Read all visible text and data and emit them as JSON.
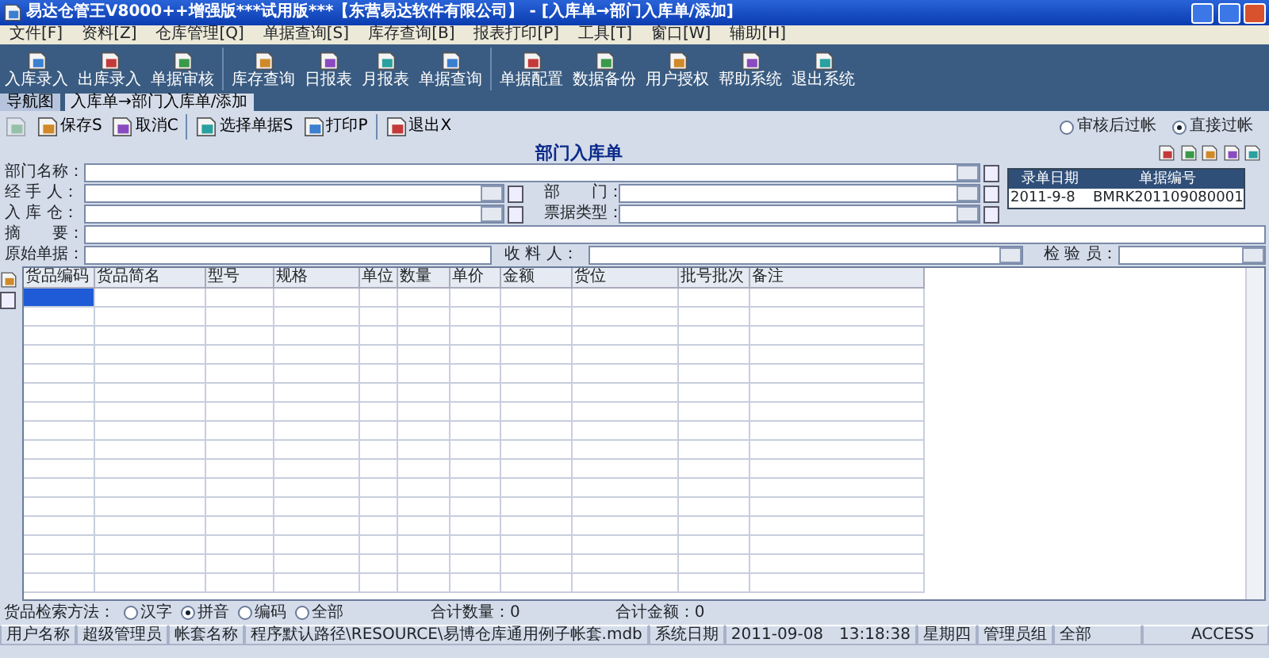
{
  "window": {
    "title": "易达仓管王V8000++增强版***试用版***【东营易达软件有限公司】 - [入库单→部门入库单/添加]"
  },
  "menu": [
    "文件[F]",
    "资料[Z]",
    "仓库管理[Q]",
    "单据查询[S]",
    "库存查询[B]",
    "报表打印[P]",
    "工具[T]",
    "窗口[W]",
    "辅助[H]"
  ],
  "toolbar": [
    [
      "入库录入",
      "出库录入",
      "单据审核"
    ],
    [
      "库存查询",
      "日报表",
      "月报表",
      "单据查询"
    ],
    [
      "单据配置",
      "数据备份",
      "用户授权",
      "帮助系统",
      "退出系统"
    ]
  ],
  "tabs": [
    {
      "label": "导航图",
      "selected": false
    },
    {
      "label": "入库单→部门入库单/添加",
      "selected": true
    }
  ],
  "subtoolbar": [
    [
      {
        "disabled": true
      },
      {
        "label": "保存S",
        "disabled": false
      },
      {
        "label": "取消C",
        "disabled": false
      }
    ],
    [
      {
        "label": "选择单据S",
        "disabled": false
      },
      {
        "label": "打印P",
        "disabled": false
      }
    ],
    [
      {
        "label": "退出X",
        "disabled": false
      }
    ]
  ],
  "posting": [
    {
      "label": "审核后过帐",
      "selected": false
    },
    {
      "label": "直接过帐",
      "selected": true
    }
  ],
  "form": {
    "title": "部门入库单",
    "fields": [
      {
        "label": "部门名称：",
        "kind": "select"
      },
      {
        "label": "经 手 人：",
        "kind": "select"
      },
      {
        "label": "部　　门：",
        "kind": "select"
      },
      {
        "label": "入 库 仓：",
        "kind": "select"
      },
      {
        "label": "票据类型：",
        "kind": "select"
      },
      {
        "label": "摘　　要：",
        "kind": "text"
      },
      {
        "label": "原始单据：",
        "kind": "text"
      },
      {
        "label": "收 料 人：",
        "kind": "select"
      },
      {
        "label": "检 验 员：",
        "kind": "select"
      }
    ],
    "doc": {
      "headers": [
        "录单日期",
        "单据编号"
      ],
      "values": [
        "2011-9-8",
        "BMRK201109080001"
      ]
    }
  },
  "table": {
    "columns": [
      "货品编码",
      "货品简名",
      "型号",
      "规格",
      "单位",
      "数量",
      "单价",
      "金额",
      "货位",
      "批号批次",
      "备注"
    ]
  },
  "search": {
    "label": "货品检索方法：",
    "options": [
      {
        "label": "汉字",
        "selected": false
      },
      {
        "label": "拼音",
        "selected": true
      },
      {
        "label": "编码",
        "selected": false
      },
      {
        "label": "全部",
        "selected": false
      }
    ],
    "total_qty": "合计数量：0",
    "total_amount": "合计金额：0"
  },
  "status_bar": [
    "用户名称",
    "超级管理员",
    "帐套名称",
    "程序默认路径\\RESOURCE\\易博仓库通用例子帐套.mdb",
    "系统日期",
    "2011-09-08　13:18:38",
    "星期四",
    "管理员组",
    "全部",
    "ACCESS"
  ]
}
